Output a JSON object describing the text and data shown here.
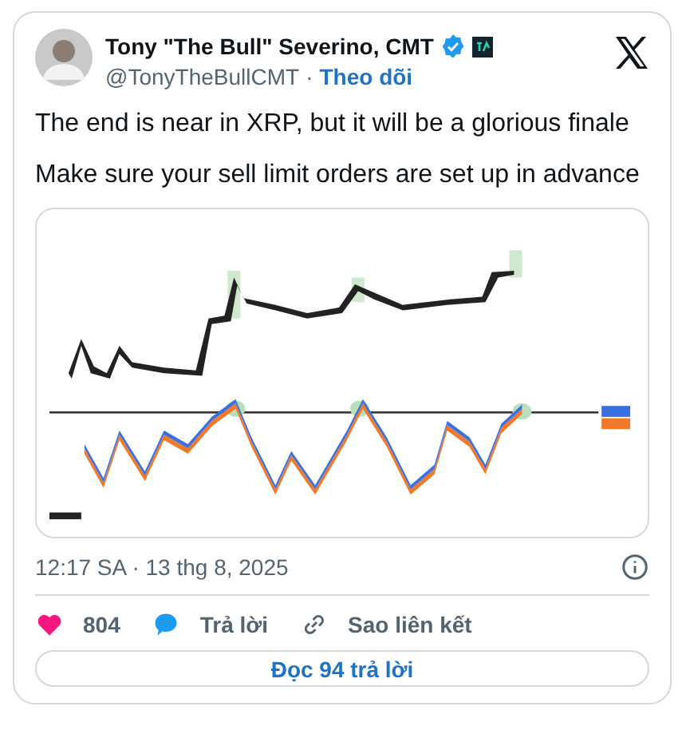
{
  "author": {
    "name": "Tony \"The Bull\" Severino, CMT",
    "handle": "@TonyTheBullCMT",
    "separator": "·",
    "follow": "Theo dõi",
    "verified": true
  },
  "text": [
    "The end is near in XRP, but it will be a glorious finale",
    "Make sure your sell limit orders are set up in advance"
  ],
  "media": {
    "kind": "picture"
  },
  "timestamp": "12:17 SA · 13 thg 8, 2025",
  "actions": [
    {
      "kind": "like",
      "label": "804"
    },
    {
      "kind": "reply",
      "label": "Trả lời"
    },
    {
      "kind": "link",
      "label": "Sao liên kết"
    }
  ],
  "read_replies": "Đọc 94 trả lời"
}
